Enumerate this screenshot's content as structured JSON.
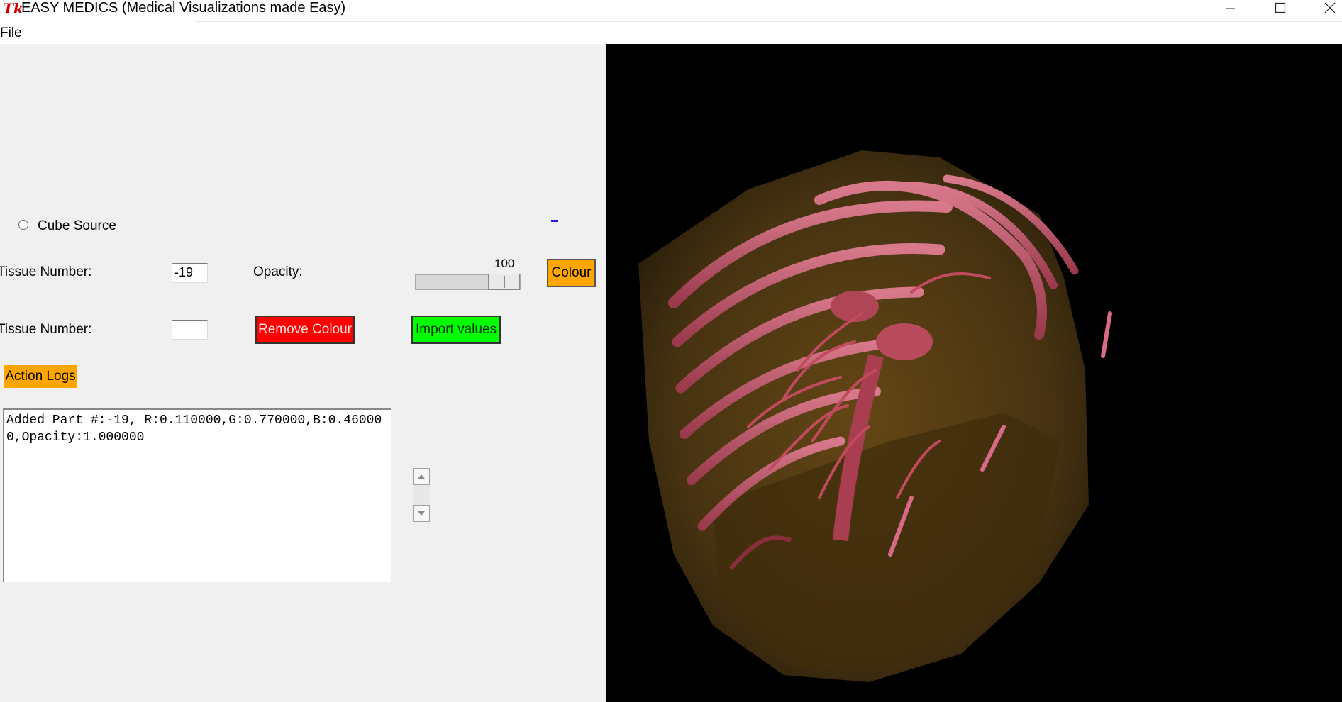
{
  "window": {
    "title": "EASY MEDICS (Medical Visualizations made Easy)",
    "icon": "tk-feather-icon"
  },
  "menu": {
    "file": "File"
  },
  "controls": {
    "radio_label": "Cube Source",
    "tissue_label_1": "Tissue Number:",
    "tissue_value_1": "-19",
    "opacity_label": "Opacity:",
    "opacity_value": "100",
    "colour_button": "Colour",
    "tissue_label_2": "Tissue Number:",
    "tissue_value_2": "",
    "remove_colour_button": "Remove Colour",
    "import_values_button": "Import values",
    "action_logs_button": "Action Logs"
  },
  "log": {
    "text": "Added Part #:-19, R:0.110000,G:0.770000,B:0.460000,Opacity:1.000000"
  },
  "colors": {
    "colour_button": "#ffa500",
    "remove_colour_button": "#ff0000",
    "import_values_button": "#00ff00",
    "action_logs_button": "#ffa500",
    "viewport_background": "#000000"
  }
}
